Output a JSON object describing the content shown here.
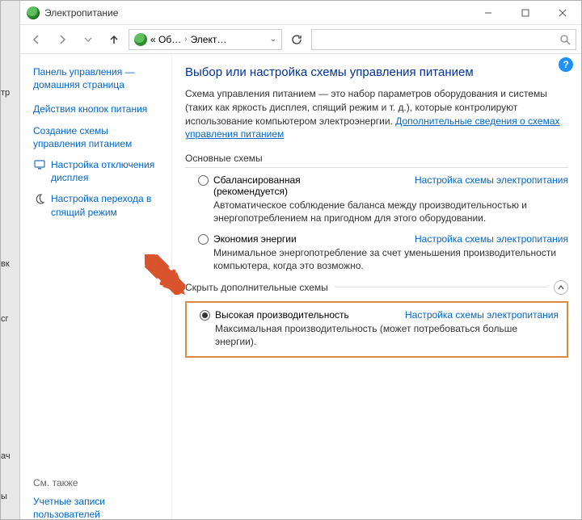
{
  "window": {
    "title": "Электропитание"
  },
  "address": {
    "crumb1": "« Об…",
    "crumb2": "Элект…"
  },
  "sidebar": {
    "home": "Панель управления — домашняя страница",
    "links": [
      {
        "label": "Действия кнопок питания",
        "icon": null
      },
      {
        "label": "Создание схемы управления питанием",
        "icon": null
      },
      {
        "label": "Настройка отключения дисплея",
        "icon": "display"
      },
      {
        "label": "Настройка перехода в спящий режим",
        "icon": "moon"
      }
    ],
    "seealso_header": "См. также",
    "seealso_link": "Учетные записи пользователей"
  },
  "main": {
    "heading": "Выбор или настройка схемы управления питанием",
    "intro_text": "Схема управления питанием — это набор параметров оборудования и системы (таких как яркость дисплея, спящий режим и т. д.), которые контролируют использование компьютером электроэнергии. ",
    "intro_link": "Дополнительные сведения о схемах управления питанием",
    "section_main": "Основные схемы",
    "section_extra": "Скрыть дополнительные схемы",
    "plan_settings_link": "Настройка схемы электропитания",
    "plans": {
      "balanced": {
        "name": "Сбалансированная",
        "rec": "(рекомендуется)",
        "desc": "Автоматическое соблюдение баланса между производительностью и энергопотреблением на пригодном для этого оборудовании."
      },
      "saver": {
        "name": "Экономия энергии",
        "desc": "Минимальное энергопотребление за счет уменьшения производительности компьютера, когда это возможно."
      },
      "high": {
        "name": "Высокая производительность",
        "desc": "Максимальная производительность (может потребоваться больше энергии)."
      }
    }
  }
}
